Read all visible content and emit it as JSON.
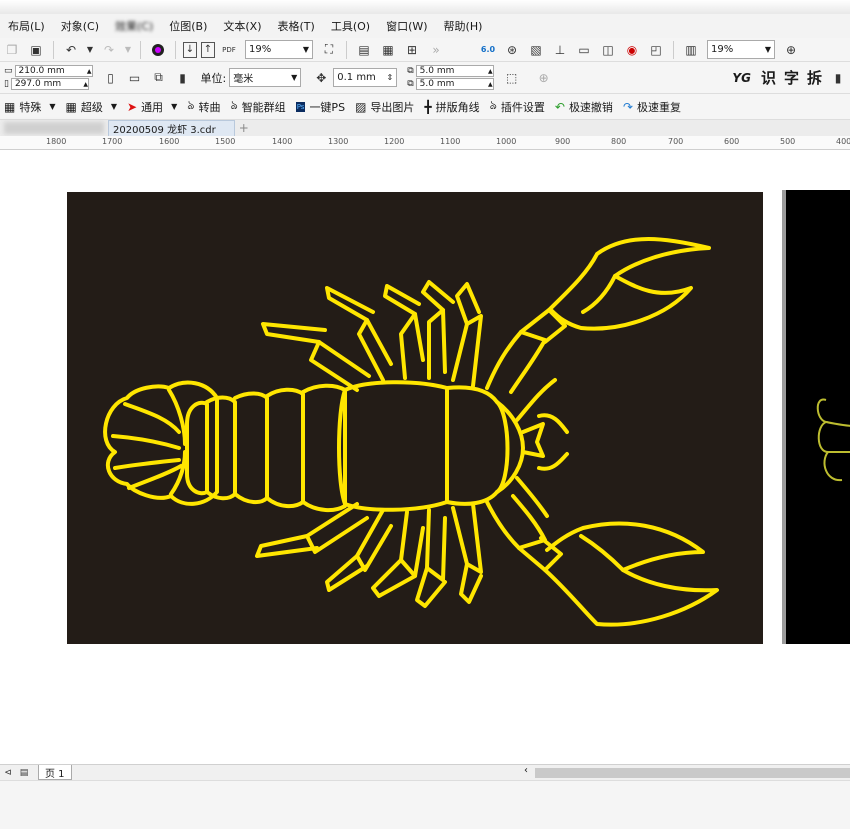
{
  "menubar": {
    "items": [
      "布局(L)",
      "对象(C)",
      "效果(C)",
      "位图(B)",
      "文本(X)",
      "表格(T)",
      "工具(O)",
      "窗口(W)",
      "帮助(H)"
    ]
  },
  "toolbar1": {
    "zoom_left": "19%",
    "zoom_right": "19%",
    "pdf_label": "PDF",
    "badge_label": "6.0"
  },
  "toolbar2": {
    "width_value": "210.0 mm",
    "height_value": "297.0 mm",
    "unit_label": "单位:",
    "unit_value": "毫米",
    "nudge_value": "0.1 mm",
    "dup_x": "5.0 mm",
    "dup_y": "5.0 mm",
    "yg_label": "YG",
    "chars": [
      "识",
      "字",
      "拆"
    ]
  },
  "toolbar3": {
    "items": [
      {
        "label": "特殊",
        "icon": "plugin-icon",
        "dropdown": true
      },
      {
        "label": "超级",
        "icon": "plugin-icon",
        "dropdown": true
      },
      {
        "label": "通用",
        "icon": "arrow-red-icon",
        "dropdown": true
      },
      {
        "label": "转曲",
        "icon": "curve-icon"
      },
      {
        "label": "智能群组",
        "icon": "curve-icon"
      },
      {
        "label": "一键PS",
        "icon": "ps-icon"
      },
      {
        "label": "导出图片",
        "icon": "image-icon"
      },
      {
        "label": "拼版角线",
        "icon": "crop-marks-icon"
      },
      {
        "label": "插件设置",
        "icon": "curve-icon"
      },
      {
        "label": "极速撤销",
        "icon": "undo-green-icon"
      },
      {
        "label": "极速重复",
        "icon": "redo-blue-icon"
      }
    ]
  },
  "tabs": {
    "active_doc": "20200509 龙虾 3.cdr",
    "add_tab": "+"
  },
  "ruler": {
    "ticks": [
      "1800",
      "1700",
      "1600",
      "1500",
      "1400",
      "1300",
      "1200",
      "1100",
      "1000",
      "900",
      "800",
      "700",
      "600",
      "500",
      "400"
    ]
  },
  "pages": {
    "page_tab": "页 1"
  },
  "colors": {
    "artboard": "#231c17",
    "outline": "#ffe600",
    "canvas": "#ffffff"
  }
}
